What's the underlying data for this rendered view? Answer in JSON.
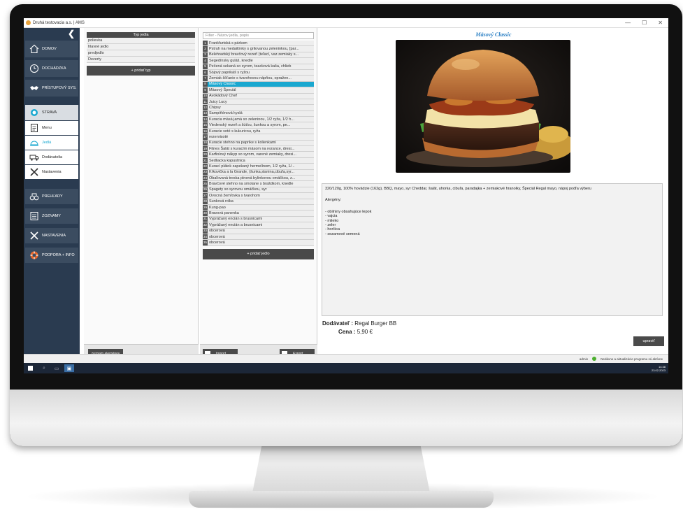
{
  "window": {
    "title": "Druhá testovacia a.s. | AMS",
    "minimize": "—",
    "maximize": "☐",
    "close": "✕"
  },
  "sidebar": {
    "toggle": "❮",
    "items": [
      {
        "label": "DOMOV",
        "icon": "home-icon"
      },
      {
        "label": "DOCHÁDZKA",
        "icon": "clock-icon"
      },
      {
        "label": "PRÍSTUPOVÝ SYS.",
        "icon": "handshake-icon"
      },
      {
        "label": "STRAVA",
        "icon": "food-icon"
      },
      {
        "label": "Menu",
        "icon": "menu-icon"
      },
      {
        "label": "Jedlá",
        "icon": "cloche-icon"
      },
      {
        "label": "Dodávatelia",
        "icon": "truck-icon"
      },
      {
        "label": "Nastavenia",
        "icon": "tools-icon"
      },
      {
        "label": "PREHĽADY",
        "icon": "binoculars-icon"
      },
      {
        "label": "ZOZNAMY",
        "icon": "list-icon"
      },
      {
        "label": "NASTAVENIA",
        "icon": "tools-icon"
      },
      {
        "label": "PODPORA + INFO",
        "icon": "lifebuoy-icon"
      }
    ]
  },
  "types": {
    "header": "Typ jedla",
    "rows": [
      "polievka",
      "hlavné jedlo",
      "predjedlo",
      "Dezerty"
    ],
    "add_label": "+ pridať typ",
    "allergens_button": "zoznam alergénov"
  },
  "meals": {
    "filter_placeholder": "Filter - Názov jedla, popis",
    "items": [
      {
        "n": "1",
        "name": "Frankfurtská s párkom"
      },
      {
        "n": "2",
        "name": "Pstruh na medailónky s grilovanou zeleninkou, [par..."
      },
      {
        "n": "3",
        "name": "Belehradský bravčový rezeň (teľací, vaz.zemiaky s..."
      },
      {
        "n": "4",
        "name": "Segedínsky guláš, knedle"
      },
      {
        "n": "5",
        "name": "Pečená sekaná so syrom, teacková kaša, chlieb"
      },
      {
        "n": "6",
        "name": "Sójový paprikáš s ryžou"
      },
      {
        "n": "7",
        "name": "Zemiak ščťanie s tvarohovou nápňou, opražen..."
      },
      {
        "n": "8",
        "name": "Mäsový Classic"
      },
      {
        "n": "9",
        "name": "Mäsový Špeciál"
      },
      {
        "n": "10",
        "name": "Avokádový Chef"
      },
      {
        "n": "11",
        "name": "Juicy Lucy"
      },
      {
        "n": "12",
        "name": "Chipsy"
      },
      {
        "n": "13",
        "name": "Šampiňónová kyslá"
      },
      {
        "n": "14",
        "name": "Kuracia mäsá jamá so zeleninou, 1/2 ryža, 1/2 h..."
      },
      {
        "n": "15",
        "name": "Viedenský rezeň a šúťou, šunkou a syrom, pe..."
      },
      {
        "n": "16",
        "name": "Kuracie soté s kukuricou, ryža"
      },
      {
        "n": "17",
        "name": "rezenrisoté"
      },
      {
        "n": "18",
        "name": "Kuracie stehno na paprike s kolienkami"
      },
      {
        "n": "19",
        "name": "Fitnes Šalát s kuracím mäsom na rezance, dresi..."
      },
      {
        "n": "20",
        "name": "Karfiolový nákyp so syrom, varené zemiaky, dresi..."
      },
      {
        "n": "21",
        "name": "Sedliacka kapustnica"
      },
      {
        "n": "22",
        "name": "Kurací plátok zapekaný hermelínom, 1/2 ryža, 1/..."
      },
      {
        "n": "23",
        "name": "Kŕkovička a la Grande, (šunka,slanina,cibuľa,syr..."
      },
      {
        "n": "24",
        "name": "Obaľovaná treska plnená bylinkovou omáčkou, z..."
      },
      {
        "n": "25",
        "name": "Bravčové stehno na smotane s brašdkom, knedle"
      },
      {
        "n": "26",
        "name": "Špagety so syrovou omáčkou, syr"
      },
      {
        "n": "27",
        "name": "Ovocná žemľovka s tvarohom"
      },
      {
        "n": "28",
        "name": "Šunková rolka"
      },
      {
        "n": "29",
        "name": "Kung-pao"
      },
      {
        "n": "30",
        "name": "Bravová panenka"
      },
      {
        "n": "31",
        "name": "Vyprážaný encián s brusnicami"
      },
      {
        "n": "32",
        "name": "Vyprážaný encián a brusnicami"
      },
      {
        "n": "33",
        "name": "obcerová"
      },
      {
        "n": "34",
        "name": "obcerová"
      },
      {
        "n": "35",
        "name": "obcerová"
      }
    ],
    "add_label": "+ pridať jedlo",
    "import_label": "Import",
    "export_label": "Export"
  },
  "detail": {
    "title": "Mäsový Classic",
    "description": "320/120g, 100% hovädzie (162g), BBQ, mayo, syr Cheddar, šalát, uhorka, cibuľa, paradajka + zemiakové hranolky, Špeciál Regal mayo, nápoj podľa výberu",
    "allergens_title": "Alergény:",
    "allergens": [
      "- obilniny obsahujúce lepok",
      "- vajcia",
      "- mlieko",
      "- zeler",
      "- horčica",
      "- sezamové semená"
    ],
    "vendor_label": "Dodávateľ :",
    "vendor_value": "Regal Burger BB",
    "price_label": "Cena :",
    "price_value": "5,90 €",
    "edit_label": "upraviť"
  },
  "status": {
    "user": "admin",
    "message": "Nedávne a aktualizácie programu sú aktívne"
  },
  "taskbar": {
    "time": "14:38",
    "date": "23.02.2023"
  }
}
